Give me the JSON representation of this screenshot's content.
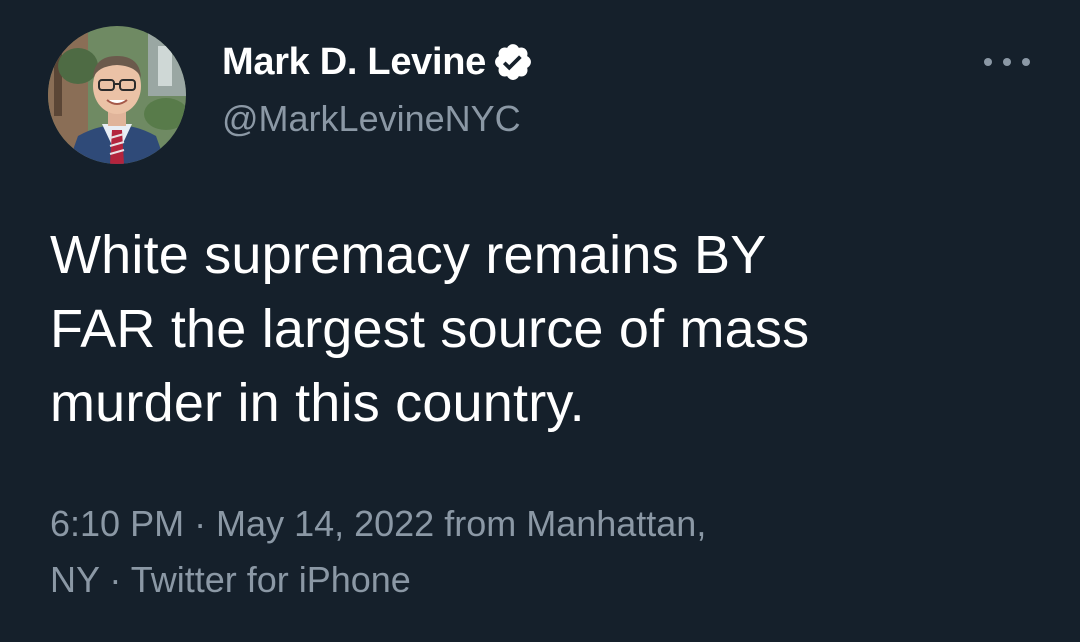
{
  "author": {
    "display_name": "Mark D. Levine",
    "handle": "@MarkLevineNYC",
    "verified": true,
    "avatar_icon": "profile-photo"
  },
  "menu": {
    "icon": "more-options-icon"
  },
  "tweet": {
    "text_lines": [
      "White supremacy remains BY",
      "FAR the largest source of mass",
      "murder in this country."
    ]
  },
  "meta": {
    "line1": "6:10 PM · May 14, 2022 from Manhattan,",
    "line2": "NY · Twitter for iPhone"
  },
  "colors": {
    "background": "#15202b",
    "primary_text": "#ffffff",
    "secondary_text": "#8b98a5"
  }
}
